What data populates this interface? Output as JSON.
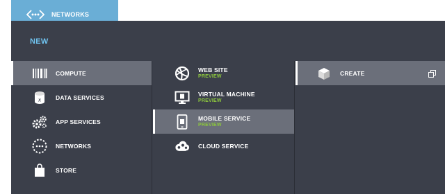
{
  "background_nav": {
    "item_label": "NETWORKS"
  },
  "flyout": {
    "title": "NEW",
    "categories": [
      {
        "label": "COMPUTE",
        "icon": "compute-icon",
        "selected": true
      },
      {
        "label": "DATA SERVICES",
        "icon": "data-services-icon"
      },
      {
        "label": "APP SERVICES",
        "icon": "app-services-icon"
      },
      {
        "label": "NETWORKS",
        "icon": "networks-icon"
      },
      {
        "label": "STORE",
        "icon": "store-icon"
      }
    ],
    "services": [
      {
        "label": "WEB SITE",
        "badge": "PREVIEW",
        "icon": "web-site-icon"
      },
      {
        "label": "VIRTUAL MACHINE",
        "badge": "PREVIEW",
        "icon": "virtual-machine-icon"
      },
      {
        "label": "MOBILE SERVICE",
        "badge": "PREVIEW",
        "icon": "mobile-service-icon",
        "selected": true
      },
      {
        "label": "CLOUD SERVICE",
        "icon": "cloud-service-icon"
      }
    ],
    "actions": [
      {
        "label": "CREATE",
        "icon": "create-box-icon",
        "selected": true
      }
    ]
  },
  "colors": {
    "panel_background": "#3b3f4a",
    "selected_background": "#6b6f7a",
    "title_accent": "#6fc2ee",
    "preview_badge": "#8cc63e",
    "background_sidebar": "#6aaed6"
  }
}
